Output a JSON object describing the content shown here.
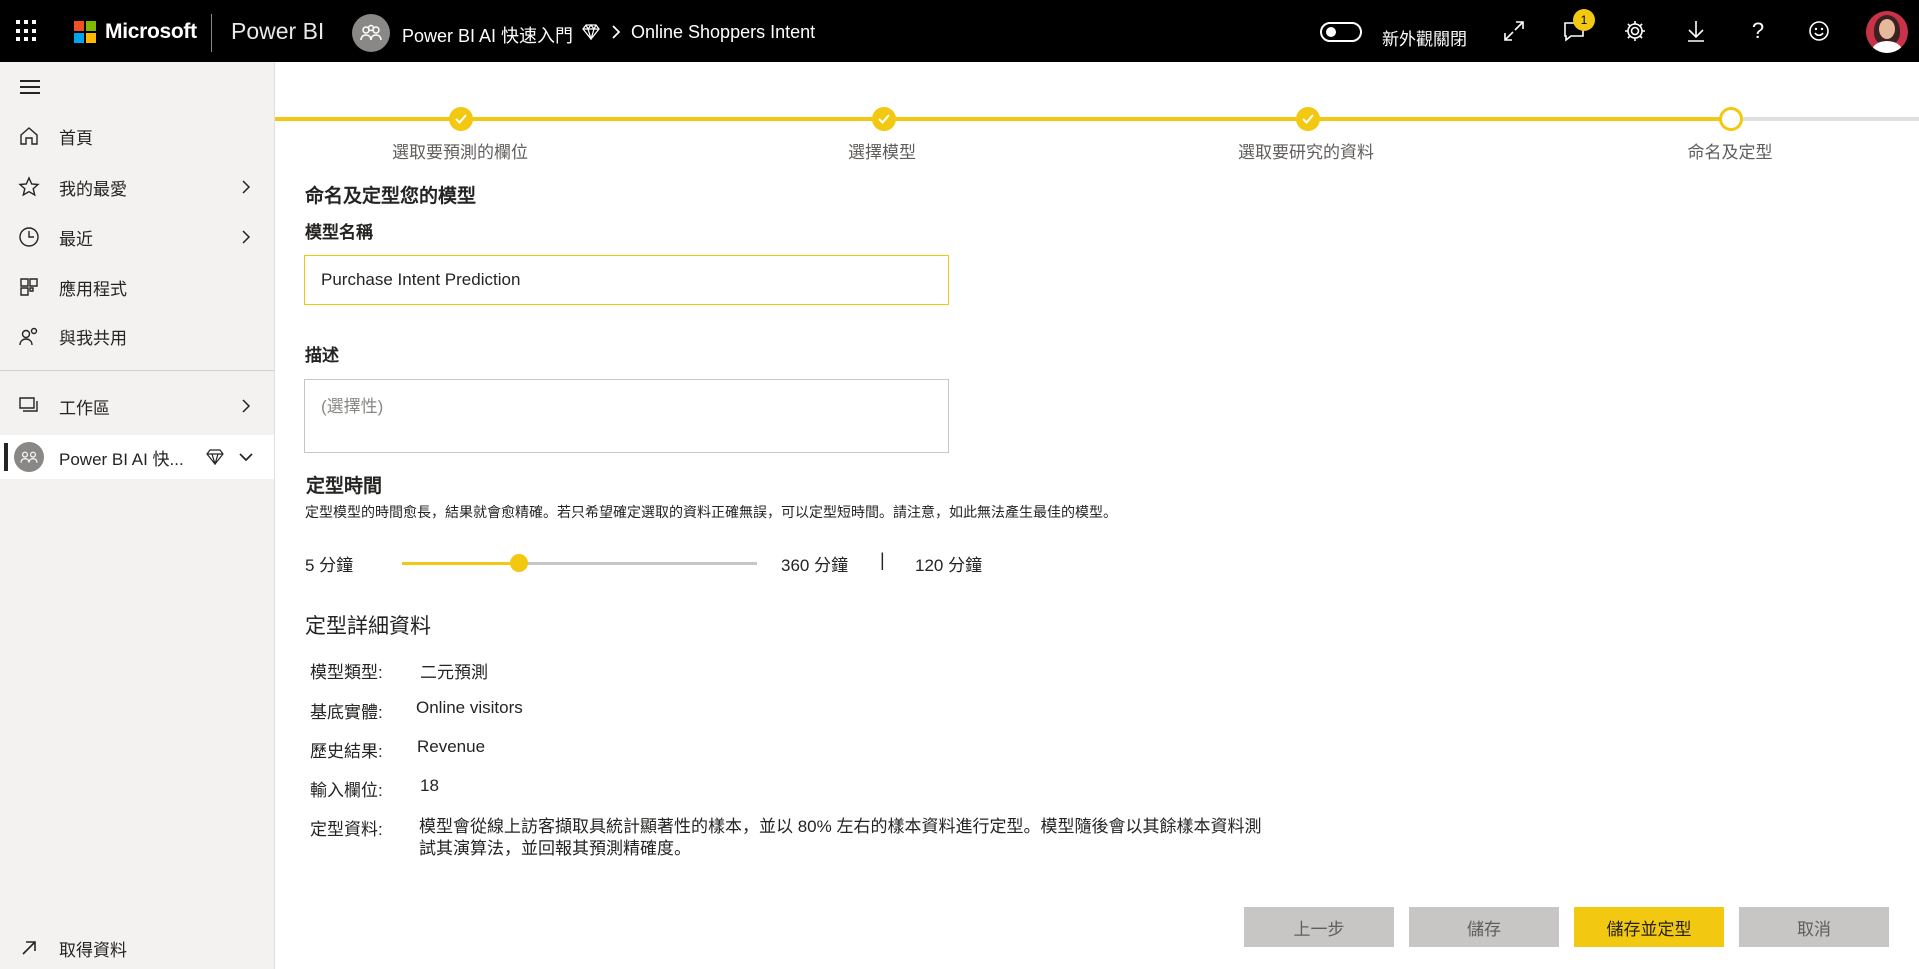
{
  "topbar": {
    "brand": "Microsoft",
    "product": "Power BI",
    "workspace": "Power BI AI 快速入門",
    "dataset": "Online Shoppers Intent",
    "toggle_label": "新外觀關閉",
    "notification_count": "1",
    "icons": [
      "waffle-icon",
      "expand-icon",
      "notification-icon",
      "gear-icon",
      "download-icon",
      "help-icon",
      "feedback-icon"
    ]
  },
  "sidebar": {
    "items": [
      {
        "label": "首頁",
        "icon": "home-icon"
      },
      {
        "label": "我的最愛",
        "icon": "star-icon"
      },
      {
        "label": "最近",
        "icon": "clock-icon"
      },
      {
        "label": "應用程式",
        "icon": "apps-icon"
      },
      {
        "label": "與我共用",
        "icon": "shared-icon"
      },
      {
        "label": "工作區",
        "icon": "workspaces-icon"
      },
      {
        "label": "Power BI AI 快...",
        "icon": "workspace-avatar"
      }
    ],
    "get_data": "取得資料"
  },
  "stepper": {
    "steps": [
      {
        "label": "選取要預測的欄位",
        "done": true
      },
      {
        "label": "選擇模型",
        "done": true
      },
      {
        "label": "選取要研究的資料",
        "done": true
      },
      {
        "label": "命名及定型",
        "done": false
      }
    ]
  },
  "form": {
    "heading": "命名及定型您的模型",
    "name_label": "模型名稱",
    "name_value": "Purchase Intent Prediction",
    "desc_label": "描述",
    "desc_placeholder": "(選擇性)",
    "time_title": "定型時間",
    "time_desc": "定型模型的時間愈長，結果就會愈精確。若只希望確定選取的資料正確無誤，可以定型短時間。請注意，如此無法產生最佳的模型。",
    "slider_min": "5 分鐘",
    "slider_max": "360 分鐘",
    "slider_sep": "|",
    "slider_value": "120 分鐘",
    "slider_fraction": 0.33
  },
  "details": {
    "title": "定型詳細資料",
    "rows": [
      {
        "key": "模型類型:",
        "value": "二元預測"
      },
      {
        "key": "基底實體:",
        "value": "Online visitors"
      },
      {
        "key": "歷史結果:",
        "value": "Revenue"
      },
      {
        "key": "輸入欄位:",
        "value": "18"
      }
    ],
    "training_key": "定型資料:",
    "training_text": "模型會從線上訪客擷取具統計顯著性的樣本，並以 80% 左右的樣本資料進行定型。模型隨後會以其餘樣本資料測試其演算法，並回報其預測精確度。"
  },
  "buttons": {
    "back": "上一步",
    "save": "儲存",
    "save_train": "儲存並定型",
    "cancel": "取消"
  },
  "colors": {
    "accent": "#f2c811",
    "topbar": "#000000",
    "sidebar": "#f3f2f1"
  }
}
